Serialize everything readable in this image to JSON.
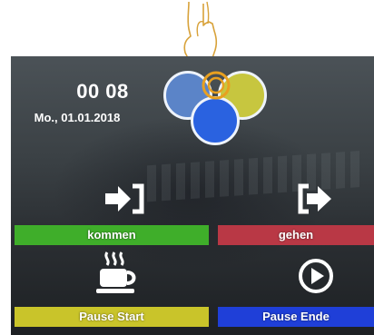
{
  "clock": {
    "time": "00 08",
    "date": "Mo., 01.01.2018"
  },
  "logo": {
    "circle_colors": [
      "#5b84c8",
      "#c7c63f",
      "#2a62e0"
    ]
  },
  "buttons": [
    {
      "label": "kommen",
      "icon": "login-arrow-icon",
      "color": "#3fae2a"
    },
    {
      "label": "gehen",
      "icon": "logout-arrow-icon",
      "color": "#b93845"
    },
    {
      "label": "Pause Start",
      "icon": "coffee-cup-icon",
      "color": "#c9c42a"
    },
    {
      "label": "Pause Ende",
      "icon": "play-circle-icon",
      "color": "#1f3fd8"
    }
  ],
  "colors": {
    "finger_outline": "#d8a23a",
    "finger_ring": "#e8a020"
  }
}
